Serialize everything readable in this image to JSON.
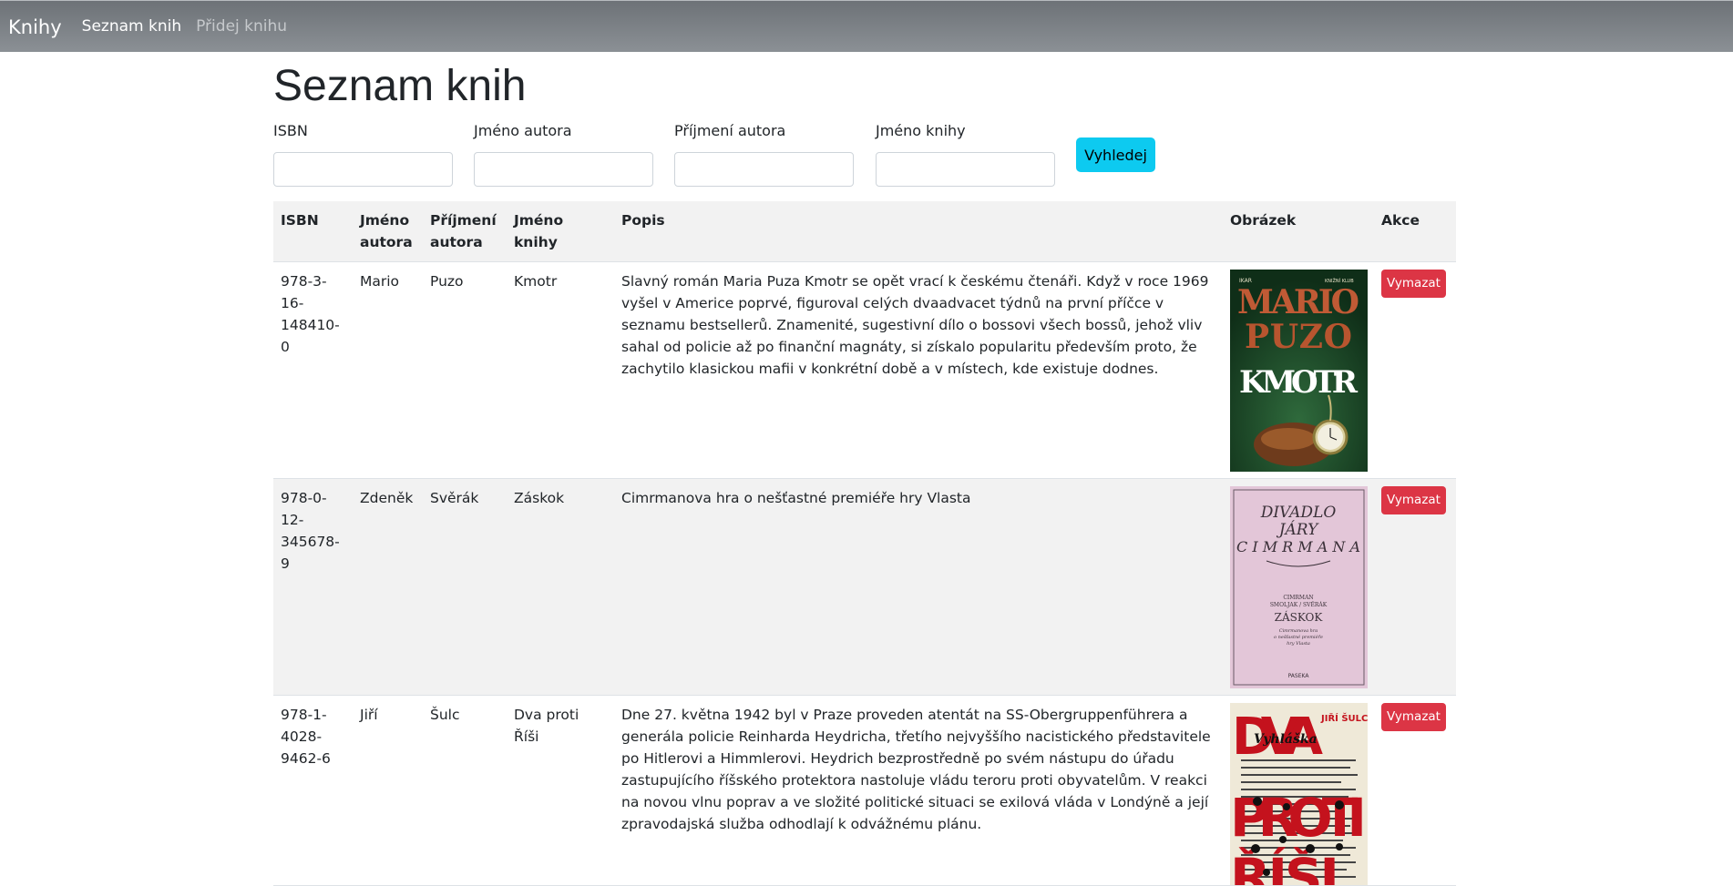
{
  "navbar": {
    "brand": "Knihy",
    "links": [
      {
        "label": "Seznam knih",
        "active": true
      },
      {
        "label": "Přidej knihu",
        "active": false
      }
    ]
  },
  "page": {
    "title": "Seznam knih"
  },
  "filters": {
    "isbn_label": "ISBN",
    "author_first_label": "Jméno autora",
    "author_last_label": "Příjmení autora",
    "book_name_label": "Jméno knihy",
    "search_button": "Vyhledej",
    "isbn_value": "",
    "author_first_value": "",
    "author_last_value": "",
    "book_name_value": ""
  },
  "table": {
    "headers": {
      "isbn": "ISBN",
      "first": "Jméno autora",
      "last": "Příjmení autora",
      "title": "Jméno knihy",
      "desc": "Popis",
      "image": "Obrázek",
      "action": "Akce"
    },
    "delete_label": "Vymazat",
    "rows": [
      {
        "isbn": "978-3-16-148410-0",
        "first": "Mario",
        "last": "Puzo",
        "title": "Kmotr",
        "desc": "Slavný román Maria Puza Kmotr se opět vrací k českému čtenáři. Když v roce 1969 vyšel v Americe poprvé, figuroval celých dvaadvacet týdnů na první příčce v seznamu bestsellerů. Znamenité, sugestivní dílo o bossovi všech bossů, jehož vliv sahal od policie až po finanční magnáty, si získalo popularitu především proto, že zachytilo klasickou mafii v konkrétní době a v místech, kde existuje dodnes.",
        "cover": {
          "publisher": "IKAR",
          "club": "KNIŽNÍ KLUB",
          "line1": "MARIO",
          "line2": "PUZO",
          "line3": "KMOTR",
          "bg": "#1d4a2a"
        }
      },
      {
        "isbn": "978-0-12-345678-9",
        "first": "Zdeněk",
        "last": "Svěrák",
        "title": "Záskok",
        "desc": "Cimrmanova hra o nešťastné premiéře hry Vlasta",
        "cover": {
          "line1": "DIVADLO",
          "line2": "JÁRY",
          "line3": "CIMRMANA",
          "authors1": "CIMRMAN",
          "authors2": "SMOLJAK / SVĚRÁK",
          "name": "ZÁSKOK",
          "sub1": "Cimrmanova hra",
          "sub2": "o nešťastné premiéře",
          "sub3": "hry Vlasta",
          "publisher": "PASEKA",
          "bg": "#e7c8dc"
        }
      },
      {
        "isbn": "978-1-4028-9462-6",
        "first": "Jiří",
        "last": "Šulc",
        "title": "Dva proti Říši",
        "desc": "Dne 27. května 1942 byl v Praze proveden atentát na SS-Obergruppenführera a generála policie Reinharda Heydricha, třetího nejvyššího nacistického představitele po Hitlerovi a Himmlerovi. Heydrich bezprostředně po svém nástupu do úřadu zastupujícího říšského protektora nastoluje vládu teroru proti obyvatelům. V reakci na novou vlnu poprav a ve složité politické situaci se exilová vláda v Londýně a její zpravodajská služba odhodlají k odvážnému plánu.",
        "cover": {
          "author": "JIŘÍ ŠULC",
          "line1": "DVA",
          "line2": "PROTI",
          "line3": "ŘÍŠI",
          "stamp": "Vyhláška",
          "bg": "#efe9d8"
        }
      }
    ]
  }
}
